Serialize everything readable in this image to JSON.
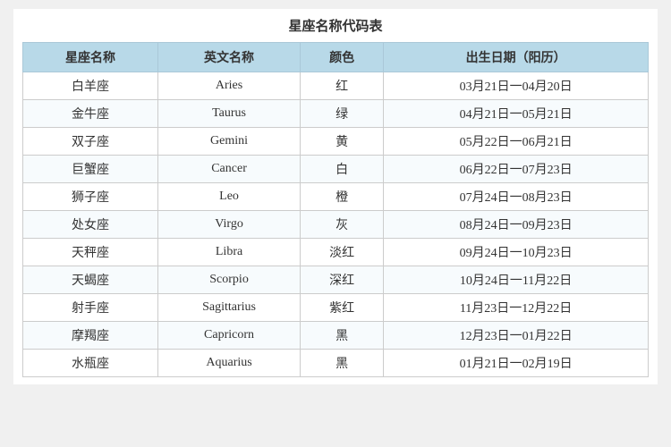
{
  "page": {
    "title": "星座名称代码表"
  },
  "table": {
    "headers": [
      "星座名称",
      "英文名称",
      "颜色",
      "出生日期（阳历）"
    ],
    "rows": [
      {
        "chinese": "白羊座",
        "english": "Aries",
        "color": "红",
        "dates": "03月21日一04月20日"
      },
      {
        "chinese": "金牛座",
        "english": "Taurus",
        "color": "绿",
        "dates": "04月21日一05月21日"
      },
      {
        "chinese": "双子座",
        "english": "Gemini",
        "color": "黄",
        "dates": "05月22日一06月21日"
      },
      {
        "chinese": "巨蟹座",
        "english": "Cancer",
        "color": "白",
        "dates": "06月22日一07月23日"
      },
      {
        "chinese": "狮子座",
        "english": "Leo",
        "color": "橙",
        "dates": "07月24日一08月23日"
      },
      {
        "chinese": "处女座",
        "english": "Virgo",
        "color": "灰",
        "dates": "08月24日一09月23日"
      },
      {
        "chinese": "天秤座",
        "english": "Libra",
        "color": "淡红",
        "dates": "09月24日一10月23日"
      },
      {
        "chinese": "天蝎座",
        "english": "Scorpio",
        "color": "深红",
        "dates": "10月24日一11月22日"
      },
      {
        "chinese": "射手座",
        "english": "Sagittarius",
        "color": "紫红",
        "dates": "11月23日一12月22日"
      },
      {
        "chinese": "摩羯座",
        "english": "Capricorn",
        "color": "黑",
        "dates": "12月23日一01月22日"
      },
      {
        "chinese": "水瓶座",
        "english": "Aquarius",
        "color": "黑",
        "dates": "01月21日一02月19日"
      }
    ]
  }
}
